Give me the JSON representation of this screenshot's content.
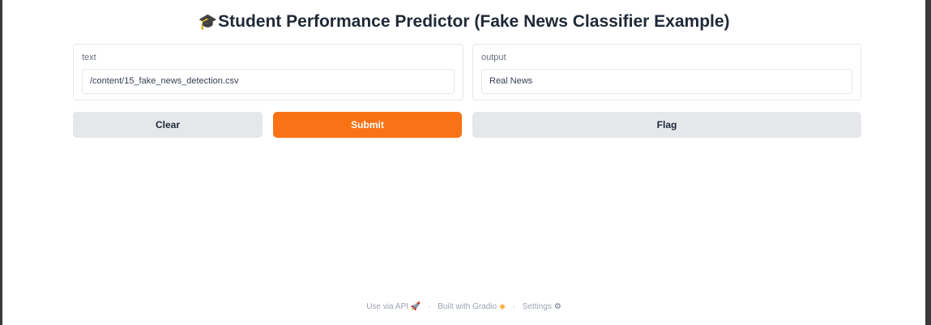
{
  "app": {
    "title_icon": "graduation-cap-icon",
    "title": "Student Performance Predictor (Fake News Classifier Example)"
  },
  "inputs": {
    "label": "text",
    "value": "/content/15_fake_news_detection.csv"
  },
  "outputs": {
    "label": "output",
    "value": "Real News"
  },
  "buttons": {
    "clear": "Clear",
    "submit": "Submit",
    "flag": "Flag"
  },
  "footer": {
    "api": "Use via API",
    "separator": "·",
    "built_with": "Built with Gradio",
    "settings": "Settings"
  },
  "colors": {
    "accent": "#f97316",
    "secondary_button": "#e5e7eb"
  }
}
